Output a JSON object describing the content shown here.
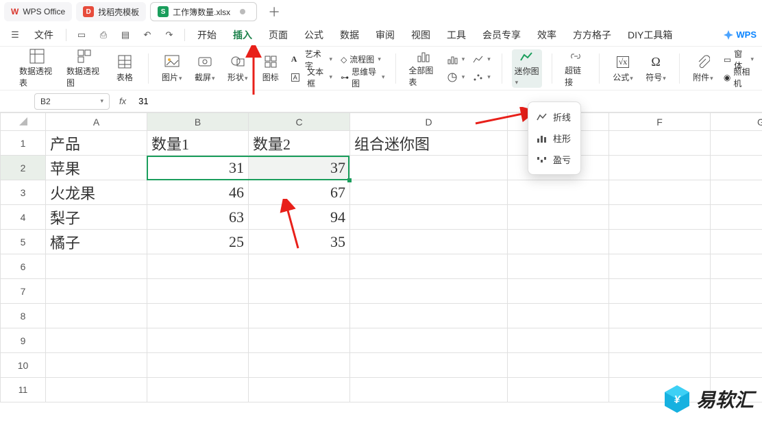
{
  "titlebar": {
    "app": "WPS Office",
    "tab2": "找稻壳模板",
    "tab3": "工作簿数量.xlsx",
    "new_tab": "＋"
  },
  "menubar": {
    "file": "文件",
    "tabs": [
      "开始",
      "插入",
      "页面",
      "公式",
      "数据",
      "审阅",
      "视图",
      "工具",
      "会员专享",
      "效率",
      "方方格子",
      "DIY工具箱"
    ],
    "active_index": 1,
    "brand": "WPS"
  },
  "ribbon": {
    "pivot_table": "数据透视表",
    "pivot_view": "数据透视图",
    "table": "表格",
    "picture": "图片",
    "screenshot": "截屏",
    "shapes": "形状",
    "icons": "图标",
    "wordart": "艺术字",
    "textbox": "文本框",
    "flowchart": "流程图",
    "mindmap": "思维导图",
    "all_charts": "全部图表",
    "sparkline": "迷你图",
    "hyperlink": "超链接",
    "formula": "公式",
    "symbol": "符号",
    "attachment": "附件",
    "form": "窗体",
    "camera": "照相机"
  },
  "formula_bar": {
    "name_box": "B2",
    "fx": "fx",
    "value": "31"
  },
  "grid": {
    "columns": [
      "A",
      "B",
      "C",
      "D",
      "E",
      "F",
      "G"
    ],
    "rows": [
      "1",
      "2",
      "3",
      "4",
      "5",
      "6",
      "7",
      "8",
      "9",
      "10",
      "11"
    ],
    "headers": {
      "A": "产品",
      "B": "数量1",
      "C": "数量2",
      "D": "组合迷你图"
    },
    "data": [
      {
        "A": "苹果",
        "B": 31,
        "C": 37
      },
      {
        "A": "火龙果",
        "B": 46,
        "C": 67
      },
      {
        "A": "梨子",
        "B": 63,
        "C": 94
      },
      {
        "A": "橘子",
        "B": 25,
        "C": 35
      }
    ],
    "selection": "B2:C2"
  },
  "dropdown": {
    "items": [
      {
        "icon": "line",
        "label": "折线"
      },
      {
        "icon": "column",
        "label": "柱形"
      },
      {
        "icon": "winloss",
        "label": "盈亏"
      }
    ]
  },
  "watermark": {
    "text": "易软汇"
  }
}
